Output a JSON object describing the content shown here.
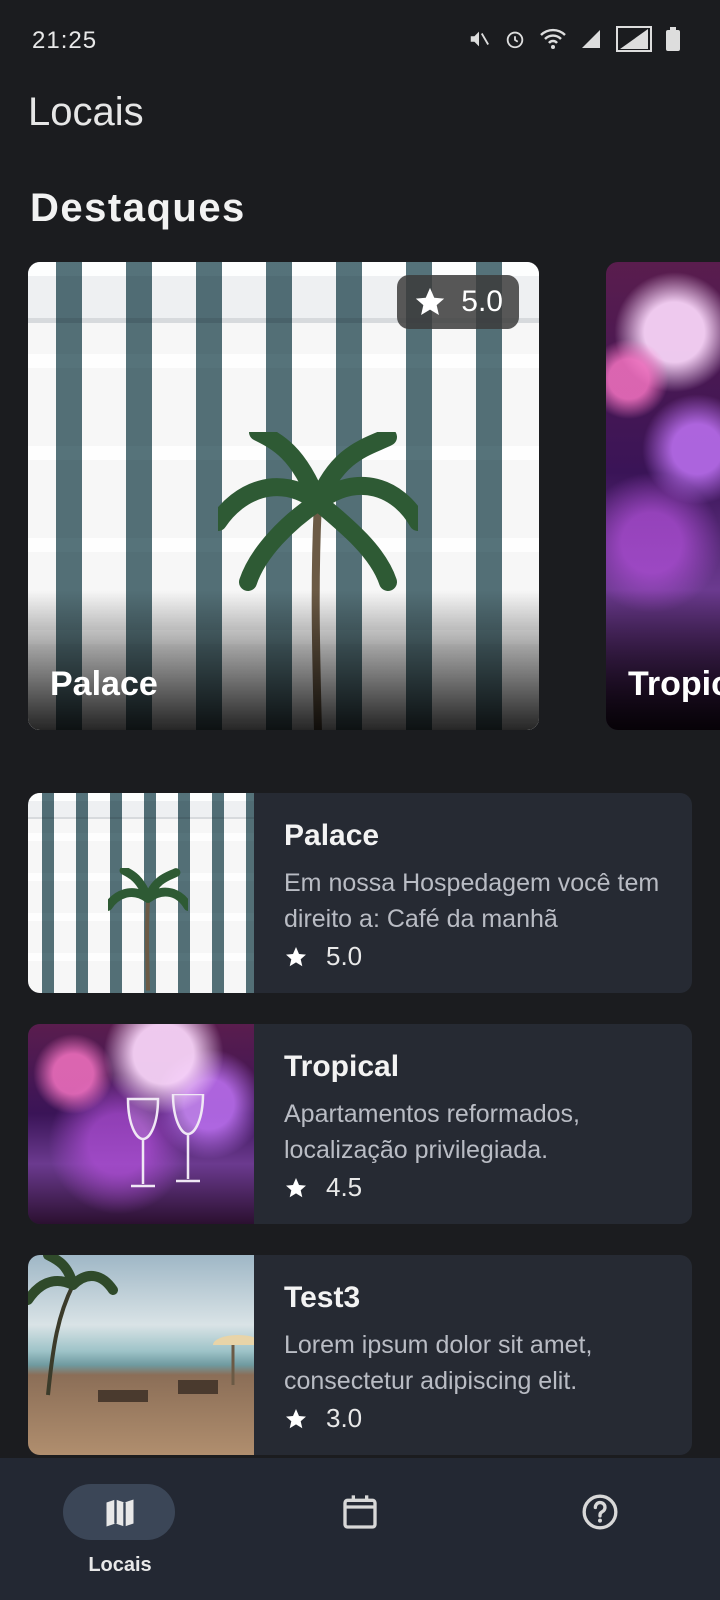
{
  "status_bar": {
    "time": "21:25",
    "icons": [
      "mute-icon",
      "alarm-icon",
      "wifi-icon",
      "signal-icon",
      "signal-icon",
      "battery-icon"
    ]
  },
  "app_title": "Locais",
  "featured": {
    "title": "Destaques",
    "cards": [
      {
        "name": "Palace",
        "rating": "5.0",
        "image": "hotel-courtyard"
      },
      {
        "name": "Tropical",
        "image": "restaurant-lights"
      }
    ]
  },
  "list": [
    {
      "name": "Palace",
      "description": "Em nossa Hospedagem você tem direito a: Café da manhã",
      "rating": "5.0",
      "image": "hotel-courtyard"
    },
    {
      "name": "Tropical",
      "description": "Apartamentos reformados, localização privilegiada.",
      "rating": "4.5",
      "image": "restaurant-lights"
    },
    {
      "name": "Test3",
      "description": "Lorem ipsum dolor sit amet, consectetur adipiscing elit.",
      "rating": "3.0",
      "image": "beach-deck"
    }
  ],
  "bottom_nav": {
    "items": [
      {
        "label": "Locais",
        "icon": "map-icon",
        "active": true
      },
      {
        "label": "",
        "icon": "calendar-icon",
        "active": false
      },
      {
        "label": "",
        "icon": "help-circle-icon",
        "active": false
      }
    ]
  },
  "colors": {
    "background": "#1b1c1f",
    "card": "#262a33",
    "nav_bg": "#232833",
    "nav_active_pill": "#3b4657"
  }
}
